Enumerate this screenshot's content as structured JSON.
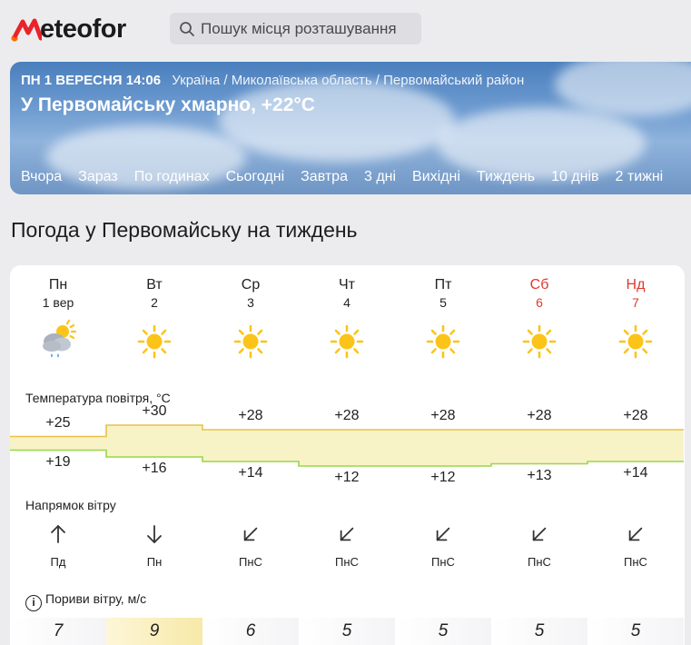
{
  "brand": {
    "logo_text": "eteofor",
    "logo_alt": "Meteofor"
  },
  "search": {
    "placeholder": "Пошук місця розташування"
  },
  "hero": {
    "date": "ПН 1 ВЕРЕСНЯ 14:06",
    "location": "Україна / Миколаївська область / Первомайський район",
    "title": "У Первомайську хмарно, +22°C",
    "tabs": [
      "Вчора",
      "Зараз",
      "По годинах",
      "Сьогодні",
      "Завтра",
      "3 дні",
      "Вихідні",
      "Тиждень",
      "10 днів",
      "2 тижні"
    ],
    "active_tab": "Тиждень"
  },
  "page": {
    "heading": "Погода у Первомайську на тиждень"
  },
  "forecast": {
    "days": [
      {
        "name": "Пн",
        "date": "1 вер",
        "weekend": false,
        "icon": "partly-cloudy-rain-icon"
      },
      {
        "name": "Вт",
        "date": "2",
        "weekend": false,
        "icon": "sun-icon"
      },
      {
        "name": "Ср",
        "date": "3",
        "weekend": false,
        "icon": "sun-icon"
      },
      {
        "name": "Чт",
        "date": "4",
        "weekend": false,
        "icon": "sun-icon"
      },
      {
        "name": "Пт",
        "date": "5",
        "weekend": false,
        "icon": "sun-icon"
      },
      {
        "name": "Сб",
        "date": "6",
        "weekend": true,
        "icon": "sun-icon"
      },
      {
        "name": "Нд",
        "date": "7",
        "weekend": true,
        "icon": "sun-icon"
      }
    ],
    "temperature_label": "Температура повітря, °C",
    "temp_max": [
      "+25",
      "+30",
      "+28",
      "+28",
      "+28",
      "+28",
      "+28"
    ],
    "temp_min": [
      "+19",
      "+16",
      "+14",
      "+12",
      "+12",
      "+13",
      "+14"
    ],
    "temp_max_values": [
      25,
      30,
      28,
      28,
      28,
      28,
      28
    ],
    "temp_min_values": [
      19,
      16,
      14,
      12,
      12,
      13,
      14
    ],
    "wind_label": "Напрямок вітру",
    "wind_dirs": [
      "Пд",
      "Пн",
      "ПнС",
      "ПнС",
      "ПнС",
      "ПнС",
      "ПнС"
    ],
    "gusts_label": "Пориви вітру, м/с",
    "gusts": [
      "7",
      "9",
      "6",
      "5",
      "5",
      "5",
      "5"
    ]
  },
  "colors": {
    "weekend": "#e2382a",
    "brand_orange": "#ff6a00",
    "brand_red": "#e8232a",
    "temp_band": "#f7f3c6",
    "temp_max_line": "#e7c24a",
    "temp_min_line": "#9bd64a",
    "sun": "#fcc419"
  }
}
